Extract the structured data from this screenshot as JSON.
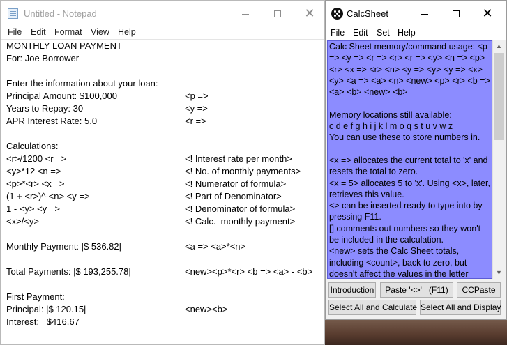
{
  "notepad": {
    "title": "Untitled - Notepad",
    "menu": [
      "File",
      "Edit",
      "Format",
      "View",
      "Help"
    ],
    "lines": [
      {
        "left": "MONTHLY LOAN PAYMENT",
        "right": ""
      },
      {
        "left": "For: Joe Borrower",
        "right": ""
      },
      {
        "left": "",
        "right": ""
      },
      {
        "left": "Enter the information about your loan:",
        "right": ""
      },
      {
        "left": "Principal Amount: $100,000",
        "right": "<p =>"
      },
      {
        "left": "Years to Repay: 30",
        "right": "<y =>"
      },
      {
        "left": "APR Interest Rate: 5.0",
        "right": "<r =>"
      },
      {
        "left": "",
        "right": ""
      },
      {
        "left": "Calculations:",
        "right": ""
      },
      {
        "left": "<r>/1200 <r =>",
        "right": "<! Interest rate per month>"
      },
      {
        "left": "<y>*12 <n =>",
        "right": "<! No. of monthly payments>"
      },
      {
        "left": "<p>*<r> <x =>",
        "right": "<! Numerator of formula>"
      },
      {
        "left": "(1 + <r>)^-<n> <y =>",
        "right": "<! Part of Denominator>"
      },
      {
        "left": "1 - <y> <y =>",
        "right": "<! Denominator of formula>"
      },
      {
        "left": "<x>/<y>",
        "right": "<! Calc.  monthly payment>"
      },
      {
        "left": "",
        "right": ""
      },
      {
        "left": "Monthly Payment: |$ 536.82|",
        "right": "<a => <a>*<n>"
      },
      {
        "left": "",
        "right": ""
      },
      {
        "left": "Total Payments: |$ 193,255.78|",
        "right": "<new><p>*<r> <b => <a> - <b>"
      },
      {
        "left": "",
        "right": ""
      },
      {
        "left": "First Payment:",
        "right": ""
      },
      {
        "left": "Principal: |$ 120.15|",
        "right": "<new><b>"
      },
      {
        "left": "Interest:   $416.67",
        "right": ""
      }
    ]
  },
  "calcsheet": {
    "title": "CalcSheet",
    "menu": [
      "File",
      "Edit",
      "Set",
      "Help"
    ],
    "help_paragraphs": [
      "Calc Sheet memory/command usage: <p => <y => <r => <r> <r => <y> <n => <p> <r> <x => <r> <n> <y => <y> <y => <x> <y> <a => <a> <n> <new> <p> <r> <b => <a> <b> <new> <b>",
      "",
      "Memory locations still available:",
      "c d e f g h i j k l m o q s t u v w z",
      "You can use these to store numbers in.",
      "",
      "<x => allocates the current total to 'x' and resets the total to zero.",
      "<x = 5> allocates 5 to 'x'. Using <x>, later, retrieves this value.",
      "<> can be inserted ready to type into by pressing F11.",
      "[] comments out numbers so they won't be included in the calculation.",
      "<new> sets the Calc Sheet totals, including <count>, back to zero, but doesn't affect the values in the letter"
    ],
    "buttons": {
      "introduction": "Introduction",
      "paste": "Paste '<>'   (F11)",
      "ccpaste": "CCPaste",
      "select_all_calculate": "Select All and Calculate",
      "select_all_display": "Select All and Display"
    }
  }
}
